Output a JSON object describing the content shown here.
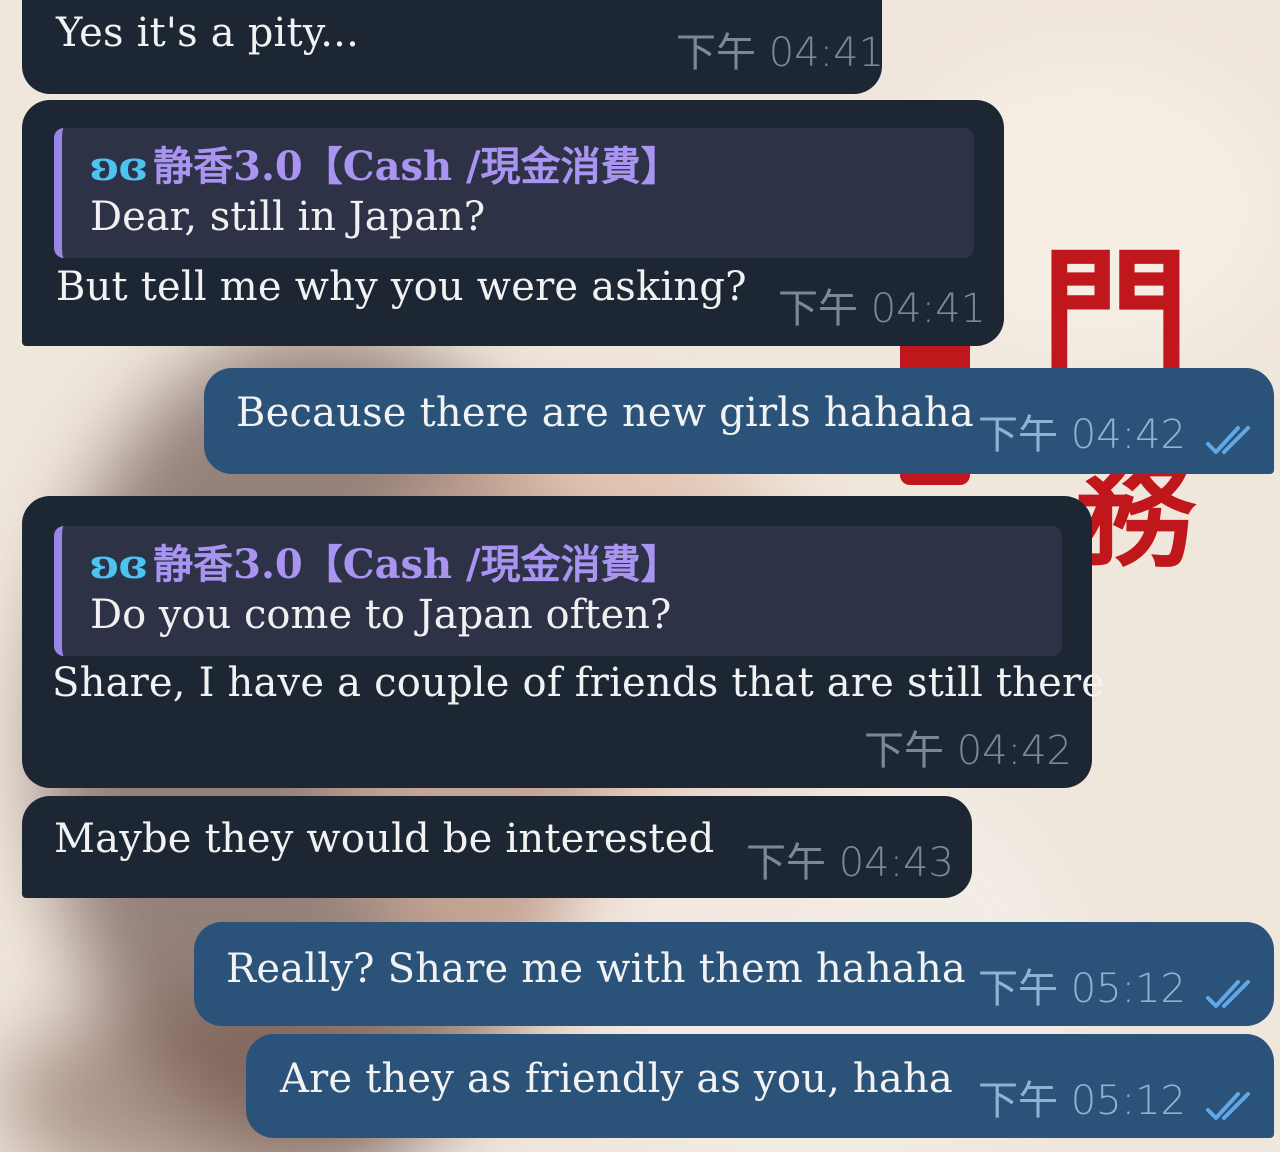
{
  "messages": [
    {
      "id": "m1",
      "direction": "in",
      "text": "Yes it's a pity...",
      "time": "下午 04:41"
    },
    {
      "id": "m2",
      "direction": "in",
      "reply": {
        "sender": "静香3.0【Cash /現金消費】",
        "sender_icon": "butterfly-icon",
        "quote": "Dear, still in Japan?"
      },
      "text": "But tell me why you were asking?",
      "time": "下午 04:41"
    },
    {
      "id": "m3",
      "direction": "out",
      "text": "Because there are new girls hahaha",
      "time": "下午 04:42",
      "status": "read"
    },
    {
      "id": "m4",
      "direction": "in",
      "reply": {
        "sender": "静香3.0【Cash /現金消費】",
        "sender_icon": "butterfly-icon",
        "quote": "Do you come to Japan often?"
      },
      "text": "Share, I have a couple of friends that are still there",
      "time": "下午 04:42"
    },
    {
      "id": "m5",
      "direction": "in",
      "text": "Maybe they would be interested",
      "time": "下午 04:43"
    },
    {
      "id": "m6",
      "direction": "out",
      "text": "Really? Share me with them hahaha",
      "time": "下午 05:12",
      "status": "read"
    },
    {
      "id": "m7",
      "direction": "out",
      "text": "Are they as friendly as you, haha",
      "time": "下午 05:12",
      "status": "read"
    }
  ],
  "colors": {
    "incoming_bubble": "#1d2733",
    "outgoing_bubble": "#2b5278",
    "reply_accent": "#9a84e6",
    "sender_name": "#a994f1",
    "read_check": "#5fa8e8"
  }
}
